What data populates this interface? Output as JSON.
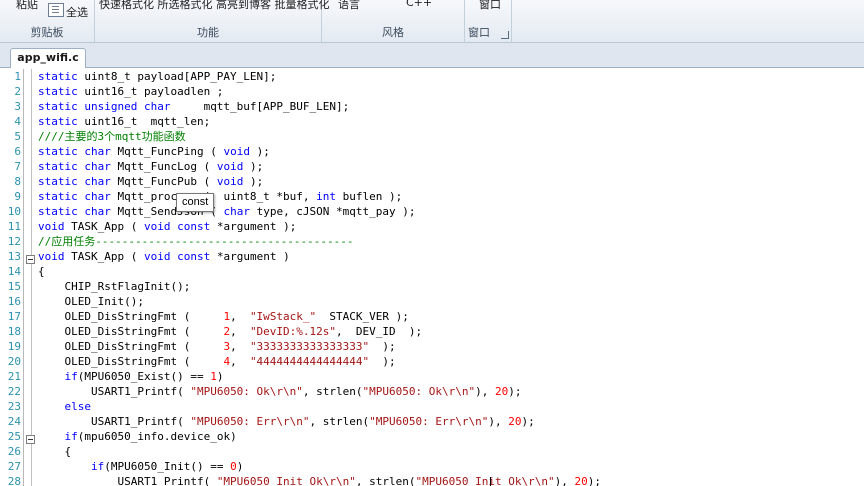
{
  "ribbon": {
    "clipboard": {
      "paste_label": "粘贴",
      "select_all_label": "全选",
      "group_title": "剪贴板"
    },
    "function": {
      "labels": "快速格式化 所选格式化 高亮到博客 批量格式化",
      "group_title": "功能"
    },
    "style": {
      "language_label": "语言",
      "cpp_label": "C++",
      "group_title": "风格"
    },
    "window": {
      "window_label": "窗口",
      "group_title": "窗口"
    }
  },
  "tab": {
    "label": "app_wifi.c"
  },
  "tooltip": {
    "text": "const"
  },
  "lines": [
    "1",
    "2",
    "3",
    "4",
    "5",
    "6",
    "7",
    "8",
    "9",
    "10",
    "11",
    "12",
    "13",
    "14",
    "15",
    "16",
    "17",
    "18",
    "19",
    "20",
    "21",
    "22",
    "23",
    "24",
    "25",
    "26",
    "27",
    "28"
  ],
  "code": [
    [
      {
        "t": "static ",
        "c": "k"
      },
      {
        "t": "uint8_t payload[APP_PAY_LEN];",
        "c": ""
      }
    ],
    [
      {
        "t": "static ",
        "c": "k"
      },
      {
        "t": "uint16_t payloadlen ;",
        "c": ""
      }
    ],
    [
      {
        "t": "static unsigned char",
        "c": "k"
      },
      {
        "t": "     mqtt_buf[APP_BUF_LEN];",
        "c": ""
      }
    ],
    [
      {
        "t": "static ",
        "c": "k"
      },
      {
        "t": "uint16_t  mqtt_len;",
        "c": ""
      }
    ],
    [
      {
        "t": "////主要的3个mqtt功能函数",
        "c": "c"
      }
    ],
    [
      {
        "t": "static char ",
        "c": "k"
      },
      {
        "t": "Mqtt_FuncPing ( ",
        "c": ""
      },
      {
        "t": "void",
        "c": "k"
      },
      {
        "t": " );",
        "c": ""
      }
    ],
    [
      {
        "t": "static char ",
        "c": "k"
      },
      {
        "t": "Mqtt_FuncLog ( ",
        "c": ""
      },
      {
        "t": "void",
        "c": "k"
      },
      {
        "t": " );",
        "c": ""
      }
    ],
    [
      {
        "t": "static char ",
        "c": "k"
      },
      {
        "t": "Mqtt_FuncPub ( ",
        "c": ""
      },
      {
        "t": "void",
        "c": "k"
      },
      {
        "t": " );",
        "c": ""
      }
    ],
    [
      {
        "t": "static char ",
        "c": "k"
      },
      {
        "t": "Mqtt_process (  uint8_t *buf, ",
        "c": ""
      },
      {
        "t": "int",
        "c": "k"
      },
      {
        "t": " buflen );",
        "c": ""
      }
    ],
    [
      {
        "t": "static char ",
        "c": "k"
      },
      {
        "t": "Mqtt_SendJson ( ",
        "c": ""
      },
      {
        "t": "char",
        "c": "k"
      },
      {
        "t": " type, cJSON *mqtt_pay );",
        "c": ""
      }
    ],
    [
      {
        "t": "void ",
        "c": "k"
      },
      {
        "t": "TASK_App ( ",
        "c": ""
      },
      {
        "t": "void const",
        "c": "k"
      },
      {
        "t": " *argument );",
        "c": ""
      }
    ],
    [
      {
        "t": "//应用任务---------------------------------------",
        "c": "c"
      }
    ],
    [
      {
        "t": "void ",
        "c": "k"
      },
      {
        "t": "TASK_App ( ",
        "c": ""
      },
      {
        "t": "void const",
        "c": "k"
      },
      {
        "t": " *argument )",
        "c": ""
      }
    ],
    [
      {
        "t": "{",
        "c": ""
      }
    ],
    [
      {
        "t": "    CHIP_RstFlagInit();",
        "c": ""
      }
    ],
    [
      {
        "t": "    OLED_Init();",
        "c": ""
      }
    ],
    [
      {
        "t": "    OLED_DisStringFmt (     ",
        "c": ""
      },
      {
        "t": "1",
        "c": "n"
      },
      {
        "t": ",  ",
        "c": ""
      },
      {
        "t": "\"IwStack_\"",
        "c": "s"
      },
      {
        "t": "  STACK_VER );",
        "c": ""
      }
    ],
    [
      {
        "t": "    OLED_DisStringFmt (     ",
        "c": ""
      },
      {
        "t": "2",
        "c": "n"
      },
      {
        "t": ",  ",
        "c": ""
      },
      {
        "t": "\"DevID:%.12s\"",
        "c": "s"
      },
      {
        "t": ",  DEV_ID  );",
        "c": ""
      }
    ],
    [
      {
        "t": "    OLED_DisStringFmt (     ",
        "c": ""
      },
      {
        "t": "3",
        "c": "n"
      },
      {
        "t": ",  ",
        "c": ""
      },
      {
        "t": "\"3333333333333333\"",
        "c": "s"
      },
      {
        "t": "  );",
        "c": ""
      }
    ],
    [
      {
        "t": "    OLED_DisStringFmt (     ",
        "c": ""
      },
      {
        "t": "4",
        "c": "n"
      },
      {
        "t": ",  ",
        "c": ""
      },
      {
        "t": "\"4444444444444444\"",
        "c": "s"
      },
      {
        "t": "  );",
        "c": ""
      }
    ],
    [
      {
        "t": "    ",
        "c": ""
      },
      {
        "t": "if",
        "c": "k"
      },
      {
        "t": "(MPU6050_Exist() == ",
        "c": ""
      },
      {
        "t": "1",
        "c": "n"
      },
      {
        "t": ")",
        "c": ""
      }
    ],
    [
      {
        "t": "        USART1_Printf( ",
        "c": ""
      },
      {
        "t": "\"MPU6050: Ok\\r\\n\"",
        "c": "s"
      },
      {
        "t": ", strlen(",
        "c": ""
      },
      {
        "t": "\"MPU6050: Ok\\r\\n\"",
        "c": "s"
      },
      {
        "t": "), ",
        "c": ""
      },
      {
        "t": "20",
        "c": "n"
      },
      {
        "t": ");",
        "c": ""
      }
    ],
    [
      {
        "t": "    ",
        "c": ""
      },
      {
        "t": "else",
        "c": "k"
      }
    ],
    [
      {
        "t": "        USART1_Printf( ",
        "c": ""
      },
      {
        "t": "\"MPU6050: Err\\r\\n\"",
        "c": "s"
      },
      {
        "t": ", strlen(",
        "c": ""
      },
      {
        "t": "\"MPU6050: Err\\r\\n\"",
        "c": "s"
      },
      {
        "t": "), ",
        "c": ""
      },
      {
        "t": "20",
        "c": "n"
      },
      {
        "t": ");",
        "c": ""
      }
    ],
    [
      {
        "t": "    ",
        "c": ""
      },
      {
        "t": "if",
        "c": "k"
      },
      {
        "t": "(mpu6050_info.device_ok)",
        "c": ""
      }
    ],
    [
      {
        "t": "    {",
        "c": ""
      }
    ],
    [
      {
        "t": "        ",
        "c": ""
      },
      {
        "t": "if",
        "c": "k"
      },
      {
        "t": "(MPU6050_Init() == ",
        "c": ""
      },
      {
        "t": "0",
        "c": "n"
      },
      {
        "t": ")",
        "c": ""
      }
    ],
    [
      {
        "t": "            USART1_Printf( ",
        "c": ""
      },
      {
        "t": "\"MPU6050 Init Ok\\r\\n\"",
        "c": "s"
      },
      {
        "t": ", strlen(",
        "c": ""
      },
      {
        "t": "\"MPU6050 Init Ok\\r\\n\"",
        "c": "s"
      },
      {
        "t": "), ",
        "c": ""
      },
      {
        "t": "20",
        "c": "n"
      },
      {
        "t": ");",
        "c": ""
      }
    ]
  ]
}
